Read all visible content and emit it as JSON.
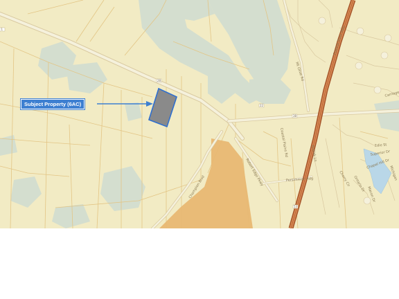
{
  "map": {
    "callout_label": "Subject Property (6AC)",
    "road_labels": {
      "mt_olive": "Mt Olive Rd",
      "parcel_road": "Coastal Plains Rd",
      "kadale_road": "Kodiak Ln",
      "interstate": "Coastal Plain Hwy",
      "champion": "Champion Blvd",
      "robert_edge": "Robert Edge Pkwy",
      "persimmon": "Persimmon Rdg",
      "edie": "Edie St",
      "superior": "Superior Dr",
      "cherry": "Cherry Cir",
      "ontario": "Ontario Dr",
      "chapel_hill": "Chapel Hill Dr",
      "macon": "Macon Dr",
      "michigan": "Michigan",
      "carriage": "Carriage",
      "hwy_1": "1",
      "hwy_2": "28",
      "hwy_3": "22",
      "hwy_4": "38",
      "hwy_5": "53"
    },
    "colors": {
      "land": "#f2ebc4",
      "parcel_line": "#e5c98a",
      "road": "#f5f1dc",
      "road_edge": "#d9c9a0",
      "interstate": "#c66c3a",
      "orange_parcel": "#e8b873",
      "wetland": "#c9d8d0",
      "subject_fill": "#808080",
      "subject_border": "#2f6fcf",
      "callout": "#3d7fd1"
    }
  }
}
